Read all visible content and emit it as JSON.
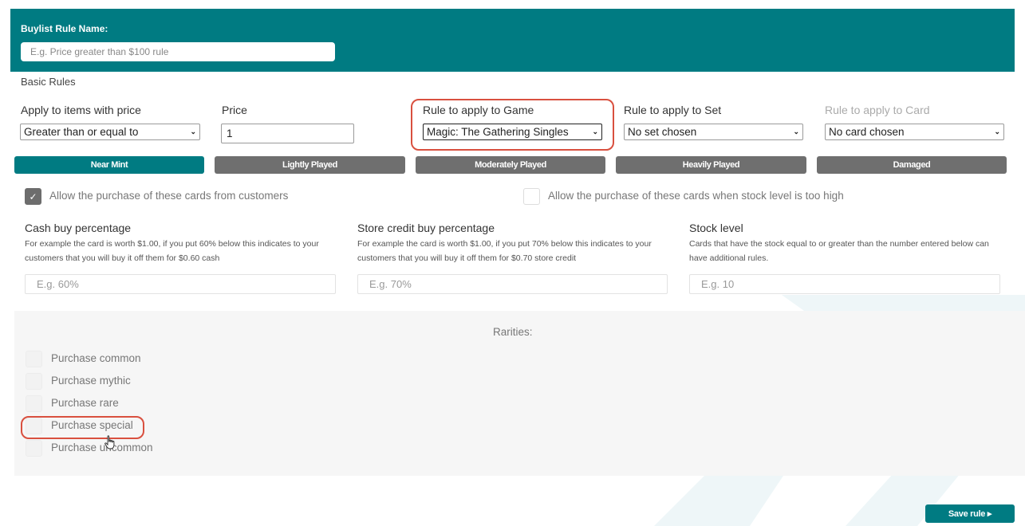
{
  "header": {
    "title": "Buylist Rule Name:",
    "name_placeholder": "E.g. Price greater than $100 rule"
  },
  "basic_rules": {
    "title": "Basic Rules",
    "price_filter": {
      "label": "Apply to items with price",
      "value": "Greater than or equal to"
    },
    "price": {
      "label": "Price",
      "value": "1"
    },
    "game": {
      "label": "Rule to apply to Game",
      "value": "Magic: The Gathering Singles"
    },
    "set": {
      "label": "Rule to apply to Set",
      "value": "No set chosen"
    },
    "card": {
      "label": "Rule to apply to Card",
      "value": "No card chosen"
    }
  },
  "conditions": [
    {
      "label": "Near Mint",
      "active": true
    },
    {
      "label": "Lightly Played",
      "active": false
    },
    {
      "label": "Moderately Played",
      "active": false
    },
    {
      "label": "Heavily Played",
      "active": false
    },
    {
      "label": "Damaged",
      "active": false
    }
  ],
  "options": {
    "allow_purchase": {
      "label": "Allow the purchase of these cards from customers",
      "checked": true
    },
    "allow_high_stock": {
      "label": "Allow the purchase of these cards when stock level is too high",
      "checked": false
    }
  },
  "cash": {
    "title": "Cash buy percentage",
    "desc1": "For example the card is worth $1.00, if you put 60% below this indicates to your",
    "desc2": "customers that you will buy it off them for $0.60 cash",
    "placeholder": "E.g. 60%"
  },
  "credit": {
    "title": "Store credit buy percentage",
    "desc1": "For example the card is worth $1.00, if you put 70% below this indicates to your",
    "desc2": "customers that you will buy it off them for $0.70 store credit",
    "placeholder": "E.g. 70%"
  },
  "stock": {
    "title": "Stock level",
    "desc1": "Cards that have the stock equal to or greater than the number entered below can",
    "desc2": "have additional rules.",
    "placeholder": "E.g. 10"
  },
  "rarities": {
    "title": "Rarities:",
    "items": [
      {
        "label": "Purchase common",
        "checked": false
      },
      {
        "label": "Purchase mythic",
        "checked": false
      },
      {
        "label": "Purchase rare",
        "checked": false
      },
      {
        "label": "Purchase special",
        "checked": false
      },
      {
        "label": "Purchase uncommon",
        "checked": false
      }
    ]
  },
  "save_button": {
    "label": "Save rule ▸"
  },
  "colors": {
    "accent": "#007b82",
    "inactive_button": "#6f6f6f",
    "highlight": "#d9503f"
  }
}
